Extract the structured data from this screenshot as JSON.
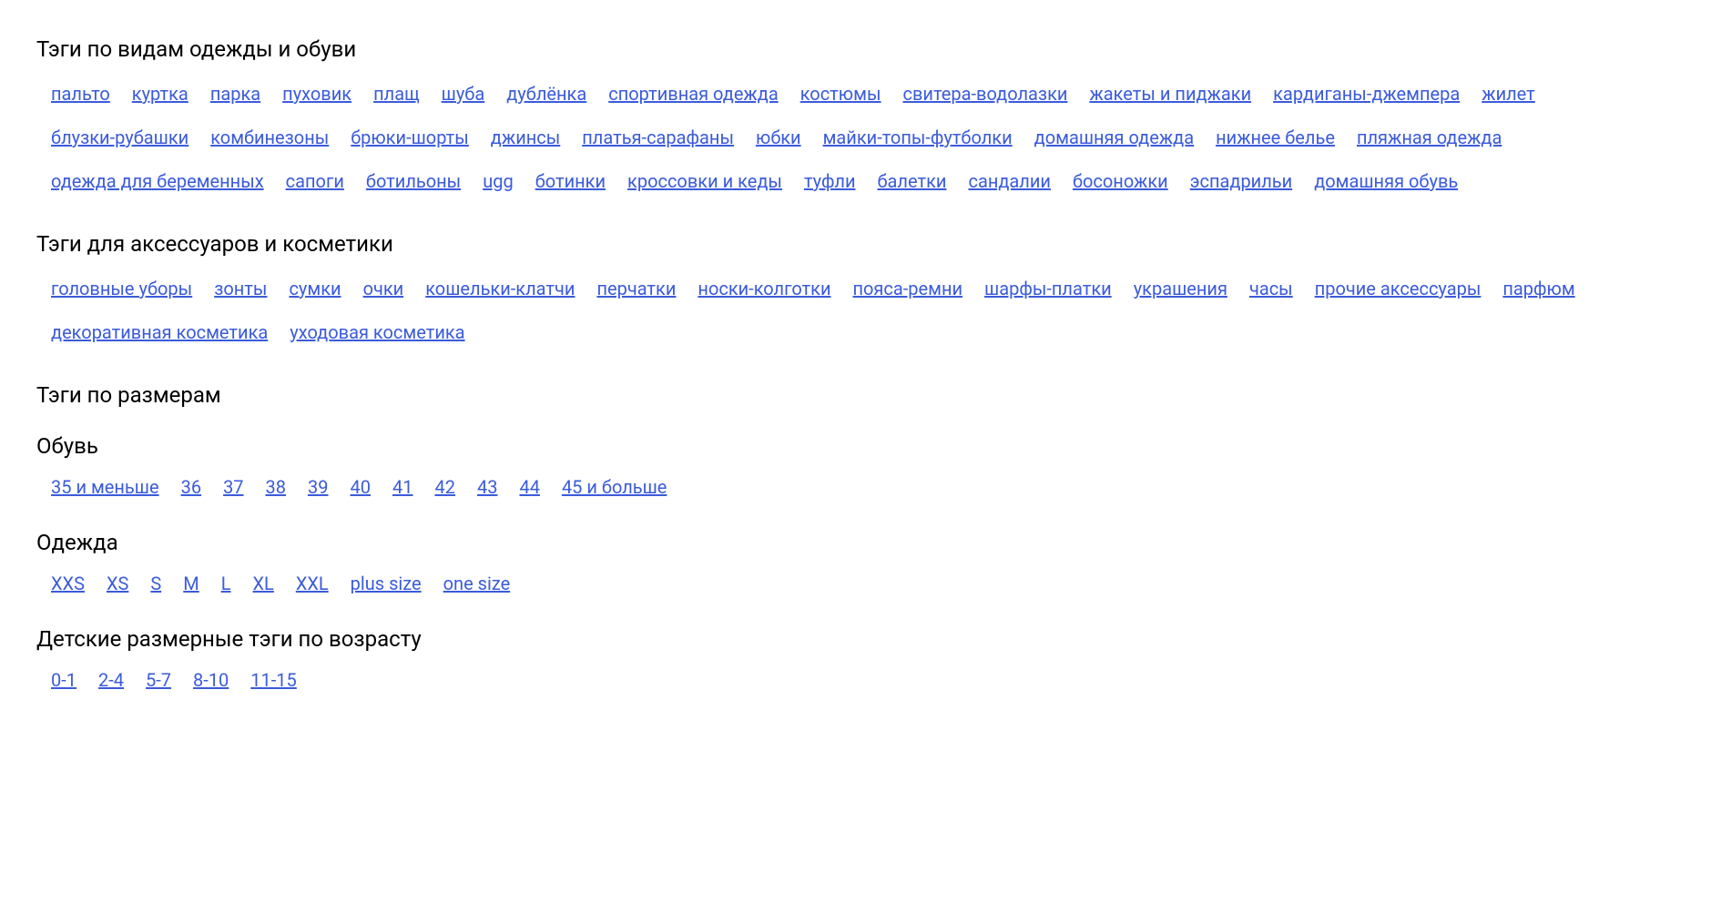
{
  "sections": {
    "clothing_shoes": {
      "heading": "Тэги по видам одежды и обуви",
      "tags": [
        "пальто",
        "куртка",
        "парка",
        "пуховик",
        "плащ",
        "шуба",
        "дублёнка",
        "спортивная одежда",
        "костюмы",
        "свитера-водолазки",
        "жакеты и пиджаки",
        "кардиганы-джемпера",
        "жилет",
        "блузки-рубашки",
        "комбинезоны",
        "брюки-шорты",
        "джинсы",
        "платья-сарафаны",
        "юбки",
        "майки-топы-футболки",
        "домашняя одежда",
        "нижнее белье",
        "пляжная одежда",
        "одежда для беременных",
        "сапоги",
        "ботильоны",
        "ugg",
        "ботинки",
        "кроссовки и кеды",
        "туфли",
        "балетки",
        "сандалии",
        "босоножки",
        "эспадрильи",
        "домашняя обувь"
      ]
    },
    "accessories_cosmetics": {
      "heading": "Тэги для аксессуаров и косметики",
      "tags": [
        "головные уборы",
        "зонты",
        "сумки",
        "очки",
        "кошельки-клатчи",
        "перчатки",
        "носки-колготки",
        "пояса-ремни",
        "шарфы-платки",
        "украшения",
        "часы",
        "прочие аксессуары",
        "парфюм",
        "декоративная косметика",
        "уходовая косметика"
      ]
    },
    "sizes": {
      "heading": "Тэги по размерам",
      "shoes": {
        "heading": "Обувь",
        "tags": [
          "35 и меньше",
          "36",
          "37",
          "38",
          "39",
          "40",
          "41",
          "42",
          "43",
          "44",
          "45 и больше"
        ]
      },
      "clothing": {
        "heading": "Одежда",
        "tags": [
          "XXS",
          "XS",
          "S",
          "M",
          "L",
          "XL",
          "XXL",
          "plus size",
          "one size"
        ]
      },
      "kids": {
        "heading": "Детские размерные тэги по возрасту",
        "tags": [
          "0-1",
          "2-4",
          "5-7",
          "8-10",
          "11-15"
        ]
      }
    }
  }
}
